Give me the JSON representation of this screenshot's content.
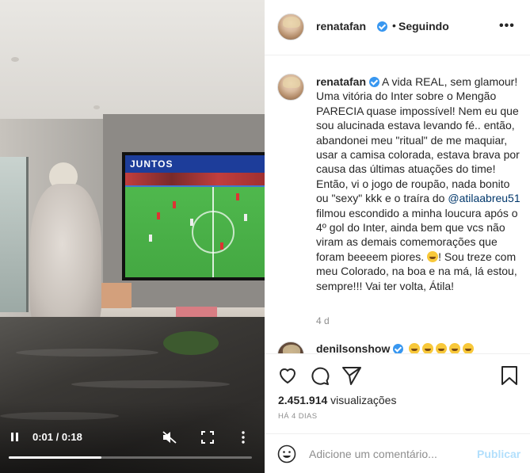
{
  "video": {
    "time_display": "0:01 / 0:18",
    "progress_fraction": 0.38,
    "tv_banner_text": "JUNTOS",
    "icons": {
      "pause": "pause-icon",
      "mute": "volume-muted-icon",
      "fullscreen": "fullscreen-icon",
      "more": "more-vertical-icon"
    }
  },
  "header": {
    "username": "renatafan",
    "separator": "•",
    "follow_status": "Seguindo",
    "more": "•••"
  },
  "caption": {
    "username": "renatafan",
    "text_part1": " A vida REAL, sem glamour! Uma vitória do Inter sobre o Mengão PARECIA quase impossível! Nem eu que sou alucinada estava levando fé.. então, abandonei meu \"ritual\" de me maquiar, usar a camisa colorada, estava brava por causa das últimas atuações do time! Então, vi o jogo de roupão, nada bonito ou \"sexy\" kkk e o traíra do ",
    "mention": "@atilaabreu51",
    "text_part2": " filmou escondido a minha loucura após o 4º gol do Inter, ainda bem que vcs não viram as demais comemorações que foram beeeem piores. ",
    "text_part3": "! Sou treze com meu Colorado, na boa e na má, lá estou, sempre!!! Vai ter volta, Átila!",
    "age": "4 d"
  },
  "comment2": {
    "username": "denilsonshow",
    "emoji_count": 5
  },
  "actions": {
    "views_count": "2.451.914",
    "views_label": " visualizações",
    "posted_ago": "HÁ 4 DIAS",
    "icons": {
      "like": "heart-icon",
      "comment": "comment-icon",
      "share": "share-icon",
      "save": "bookmark-icon"
    }
  },
  "add_comment": {
    "placeholder": "Adicione um comentário...",
    "post_label": "Publicar",
    "emoji_icon": "smile-icon"
  },
  "colors": {
    "verified_blue": "#3897f0",
    "publish_disabled": "#b2dffc",
    "mention": "#00376b",
    "muted_text": "#8e8e8e"
  }
}
